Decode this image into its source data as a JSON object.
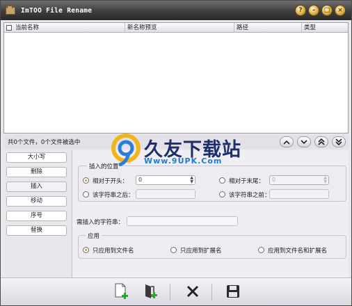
{
  "window": {
    "title": "ImTOO File Rename",
    "buttons": [
      "?",
      "–",
      "□",
      "×"
    ]
  },
  "filelist": {
    "columns": [
      "当前名称",
      "新名称预览",
      "路径",
      "类型"
    ]
  },
  "status": {
    "text": "共0个文件，0个文件被选中"
  },
  "sort_buttons": [
    "⌃",
    "⌄",
    "︽",
    "︾"
  ],
  "left_tabs": [
    "大小写",
    "删除",
    "插入",
    "移动",
    "序号",
    "替换"
  ],
  "insert_panel": {
    "position_group_label": "插入的位置",
    "from_start_label": "相对于开头：",
    "from_start_value": "0",
    "from_end_label": "相对于末尾：",
    "from_end_value": "0",
    "after_string_label": "该字符串之后：",
    "before_string_label": "该字符串之前：",
    "insert_string_label": "需插入的字符串：",
    "apply_group_label": "应用",
    "apply_filename_label": "只应用到文件名",
    "apply_extension_label": "只应用到扩展名",
    "apply_both_label": "应用到文件名和扩展名"
  },
  "watermark": {
    "text": "久友下载站",
    "url": "Www.9UPK.Com"
  },
  "icons": {
    "add_file": "add-file-icon",
    "add_folder": "add-folder-icon",
    "delete": "delete-icon",
    "save": "save-icon"
  },
  "colors": {
    "titlebar": "#3d3d3d",
    "radio_selected": "#c89a2c",
    "add_green": "#2fa52f"
  }
}
